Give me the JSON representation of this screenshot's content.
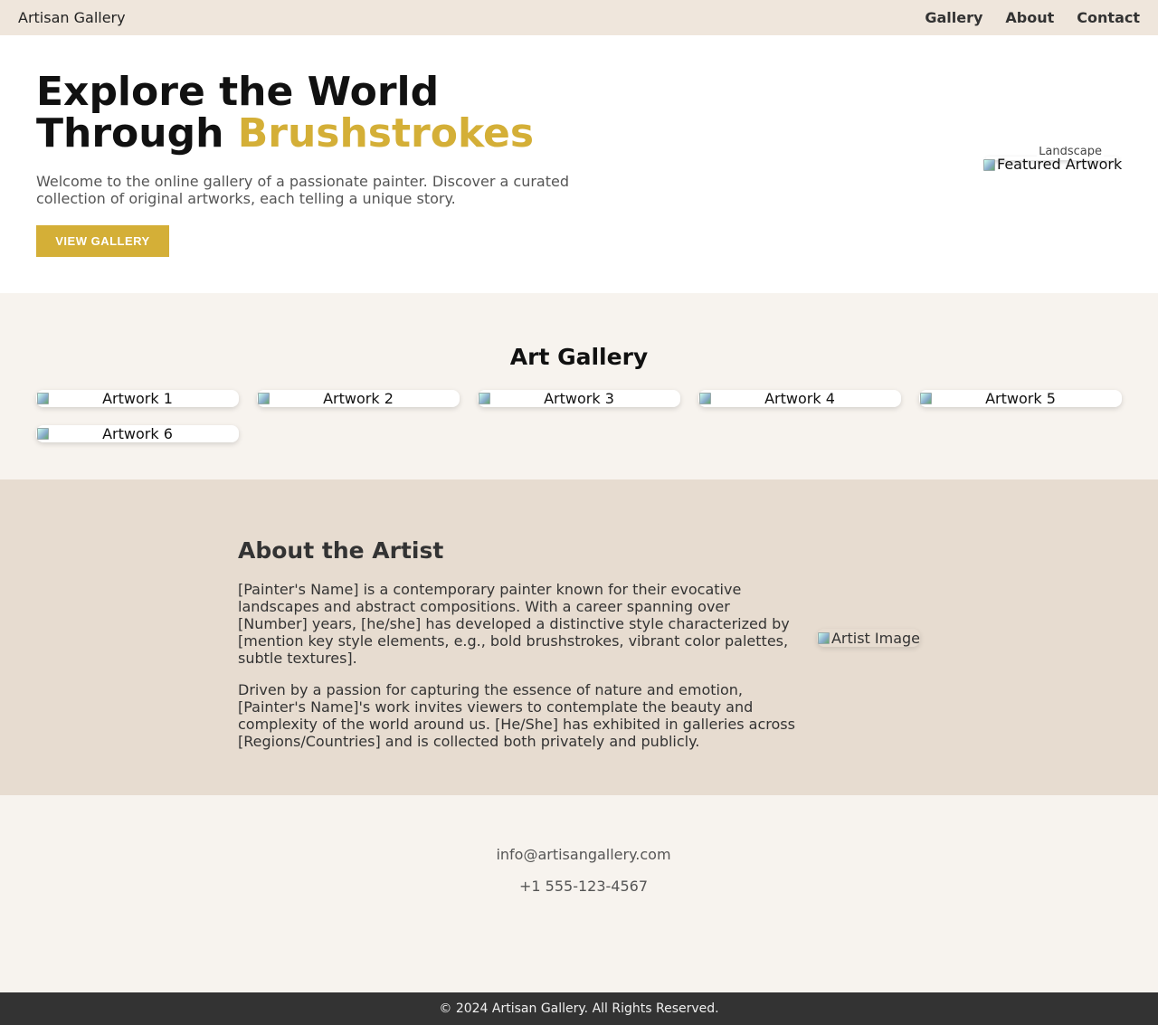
{
  "nav": {
    "brand": "Artisan Gallery",
    "links": [
      "Gallery",
      "About",
      "Contact"
    ]
  },
  "hero": {
    "title_line1": "Explore the World",
    "title_line2_prefix": "Through ",
    "title_accent": "Brushstrokes",
    "intro": "Welcome to the online gallery of a passionate painter. Discover a curated collection of original artworks, each telling a unique story.",
    "cta_label": "VIEW GALLERY",
    "featured_caption": "Landscape",
    "featured_alt": "Featured Artwork"
  },
  "gallery": {
    "title": "Art Gallery",
    "artworks": [
      "Artwork 1",
      "Artwork 2",
      "Artwork 3",
      "Artwork 4",
      "Artwork 5",
      "Artwork 6"
    ]
  },
  "about": {
    "title": "About the Artist",
    "paragraph1": "[Painter's Name] is a contemporary painter known for their evocative landscapes and abstract compositions. With a career spanning over [Number] years, [he/she] has developed a distinctive style characterized by [mention key style elements, e.g., bold brushstrokes, vibrant color palettes, subtle textures].",
    "paragraph2": "Driven by a passion for capturing the essence of nature and emotion, [Painter's Name]'s work invites viewers to contemplate the beauty and complexity of the world around us. [He/She] has exhibited in galleries across [Regions/Countries] and is collected both privately and publicly.",
    "image_alt": "Artist Image"
  },
  "contact": {
    "email": "info@artisangallery.com",
    "phone": "+1 555-123-4567"
  },
  "footer": {
    "text": "© 2024 Artisan Gallery. All Rights Reserved."
  },
  "colors": {
    "accent": "#d4af37",
    "nav_bg": "#efe6dc",
    "section_bg": "#f7f3ee",
    "about_bg": "#e7dcd0",
    "footer_bg": "#333333"
  }
}
